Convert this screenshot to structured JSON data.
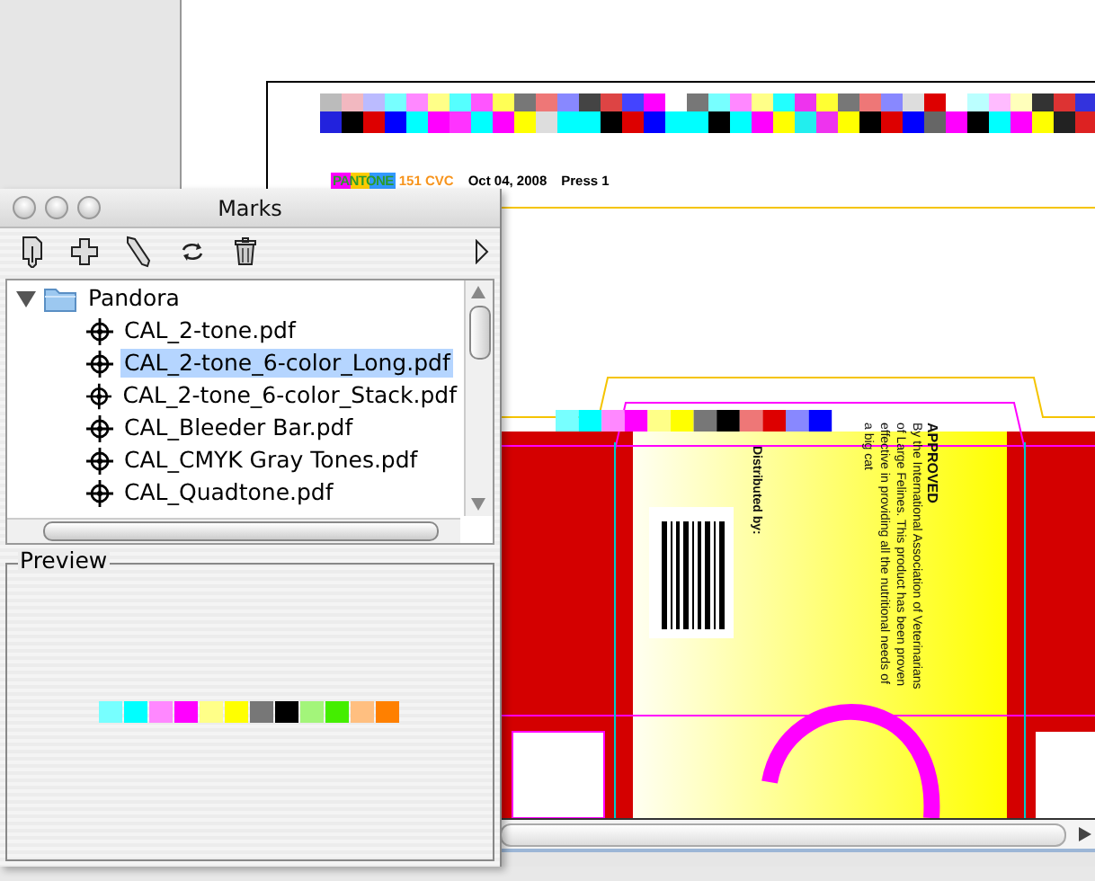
{
  "document": {
    "caption": {
      "ink": "PANTONE",
      "ink_number": "151 CVC",
      "date": "Oct 04, 2008",
      "press": "Press 1"
    },
    "package": {
      "heading": "APPROVED",
      "claim": "By the International Association of Veterinarians of Large Felines. This product has been proven effective in providing all the nutritional needs of a big cat",
      "distributor_label": "Distributed by:"
    }
  },
  "palette": {
    "title": "Marks",
    "tree": [
      {
        "label": "Pandora",
        "kind": "folder",
        "expanded": true,
        "selected": false,
        "children": [
          {
            "label": "CAL_2-tone.pdf",
            "kind": "mark",
            "selected": false
          },
          {
            "label": "CAL_2-tone_6-color_Long.pdf",
            "kind": "mark",
            "selected": true
          },
          {
            "label": "CAL_2-tone_6-color_Stack.pdf",
            "kind": "mark",
            "selected": false
          },
          {
            "label": "CAL_Bleeder Bar.pdf",
            "kind": "mark",
            "selected": false
          },
          {
            "label": "CAL_CMYK Gray Tones.pdf",
            "kind": "mark",
            "selected": false
          },
          {
            "label": "CAL_Quadtone.pdf",
            "kind": "mark",
            "selected": false
          }
        ]
      }
    ],
    "preview": {
      "title": "Preview"
    }
  }
}
